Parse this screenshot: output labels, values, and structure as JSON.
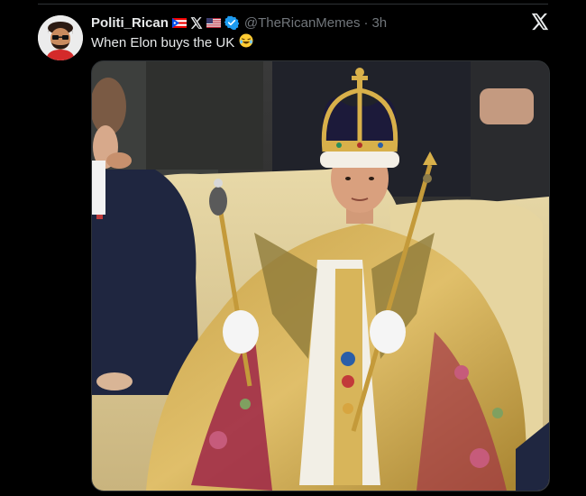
{
  "tweet": {
    "display_name": "Politi_Rican",
    "handle": "@TheRicanMemes",
    "separator": "·",
    "timestamp": "3h",
    "text": "When Elon buys the UK",
    "emoji_icon": "laughing-face-emoji",
    "name_badges": [
      "puerto-rico-flag-icon",
      "x-logo-icon",
      "us-flag-icon",
      "verified-badge-icon"
    ]
  },
  "media": {
    "description_icon": "coronation-photo"
  },
  "colors": {
    "background": "#000000",
    "text_primary": "#e7e9ea",
    "text_secondary": "#71767b",
    "verified_blue": "#1d9bf0",
    "divider": "#2f3336"
  }
}
